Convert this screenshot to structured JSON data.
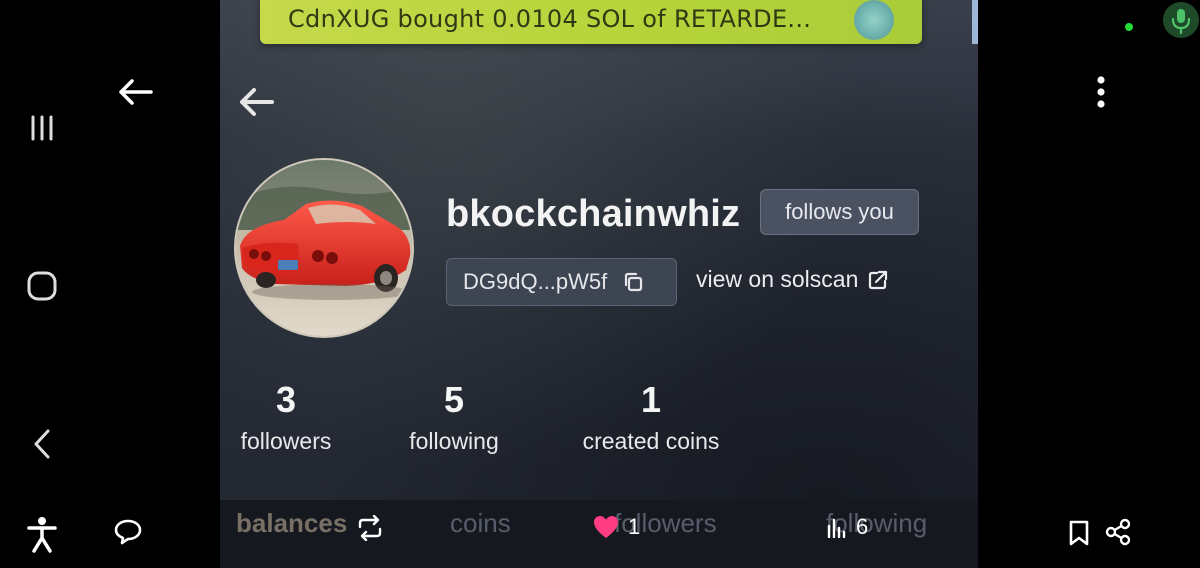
{
  "toast": {
    "text": "CdnXUG bought 0.0104 SOL of RETARDE..."
  },
  "profile": {
    "username": "bkockchainwhiz",
    "follows_badge": "follows you",
    "address": "DG9dQ...pW5f",
    "solscan_label": "view on solscan"
  },
  "stats": [
    {
      "value": "3",
      "label": "followers"
    },
    {
      "value": "5",
      "label": "following"
    },
    {
      "value": "1",
      "label": "created coins"
    }
  ],
  "tabs": [
    {
      "label": "balances",
      "active": true
    },
    {
      "label": "coins",
      "active": false
    },
    {
      "label": "followers",
      "active": false
    },
    {
      "label": "following",
      "active": false
    }
  ],
  "post_actions": {
    "likes": "1",
    "views": "6"
  },
  "colors": {
    "toast_bg": "#b6d339",
    "like_heart": "#ff3d83",
    "status_dot": "#22dd33"
  },
  "icons": {
    "system_back": "arrow-left-icon",
    "recents": "recents-icon",
    "home": "home-icon",
    "nav_back": "chevron-left-icon",
    "accessibility": "accessibility-icon",
    "reply": "speech-bubble-icon",
    "more": "more-vertical-icon",
    "mic": "mic-icon",
    "repost": "repost-icon",
    "like": "heart-icon",
    "views": "bar-chart-icon",
    "bookmark": "bookmark-icon",
    "share": "share-icon",
    "copy": "copy-icon",
    "external": "external-link-icon"
  }
}
